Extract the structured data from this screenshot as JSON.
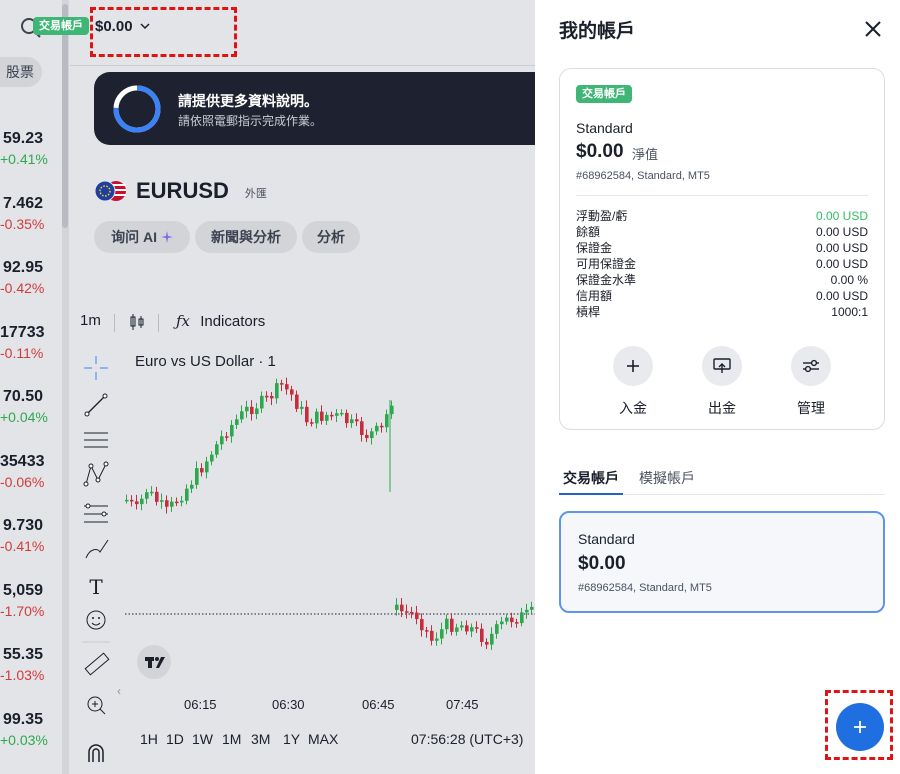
{
  "ticker": {
    "tab_label": "股票",
    "rows": [
      {
        "price": "59.23",
        "change": "+0.41%",
        "dir": "up"
      },
      {
        "price": "7.462",
        "change": "-0.35%",
        "dir": "dn"
      },
      {
        "price": "92.95",
        "change": "-0.42%",
        "dir": "dn"
      },
      {
        "price": "17733",
        "change": "-0.11%",
        "dir": "dn"
      },
      {
        "price": "70.50",
        "change": "+0.04%",
        "dir": "up"
      },
      {
        "price": "35433",
        "change": "-0.06%",
        "dir": "dn"
      },
      {
        "price": "9.730",
        "change": "-0.41%",
        "dir": "dn"
      },
      {
        "price": "5,059",
        "change": "-1.70%",
        "dir": "dn"
      },
      {
        "price": "55.35",
        "change": "-1.03%",
        "dir": "dn"
      },
      {
        "price": "99.35",
        "change": "+0.03%",
        "dir": "up"
      }
    ]
  },
  "header": {
    "account_badge": "交易帳戶",
    "balance": "$0.00"
  },
  "banner": {
    "title": "請提供更多資料說明。",
    "subtitle": "請依照電郵指示完成作業。"
  },
  "symbol": {
    "name": "EURUSD",
    "type": "外匯"
  },
  "pills": {
    "ask_ai": "询问 AI",
    "news": "新聞與分析",
    "analysis": "分析"
  },
  "chart_toolbar": {
    "interval": "1m",
    "indicators": "Indicators"
  },
  "chart": {
    "title": "Euro vs US Dollar · 1",
    "x_ticks": [
      "06:15",
      "06:30",
      "06:45",
      "07:45"
    ],
    "timeframes": [
      "1H",
      "1D",
      "1W",
      "1M",
      "3M",
      "1Y",
      "MAX"
    ],
    "time": "07:56:28 (UTC+3)",
    "candle_up_color": "#2ea84f",
    "candle_down_color": "#c72d3c"
  },
  "panel": {
    "title": "我的帳戶",
    "card": {
      "badge": "交易帳戶",
      "name": "Standard",
      "balance": "$0.00",
      "net_label": "淨值",
      "sub": "#68962584, Standard, MT5",
      "metrics": [
        {
          "label": "浮動盈/虧",
          "value": "0.00 USD",
          "green": true
        },
        {
          "label": "餘額",
          "value": "0.00 USD",
          "green": false
        },
        {
          "label": "保證金",
          "value": "0.00 USD",
          "green": false
        },
        {
          "label": "可用保證金",
          "value": "0.00 USD",
          "green": false
        },
        {
          "label": "保證金水準",
          "value": "0.00 %",
          "green": false
        },
        {
          "label": "信用額",
          "value": "0.00 USD",
          "green": false
        },
        {
          "label": "槓桿",
          "value": "1000:1",
          "green": false
        }
      ],
      "actions": {
        "deposit": "入金",
        "withdraw": "出金",
        "manage": "管理"
      }
    },
    "tabs": {
      "real": "交易帳戶",
      "demo": "模擬帳戶"
    },
    "account": {
      "name": "Standard",
      "balance": "$0.00",
      "sub": "#68962584, Standard, MT5"
    }
  },
  "accent_color": "#1f6fe0",
  "badge_color": "#3fb676"
}
